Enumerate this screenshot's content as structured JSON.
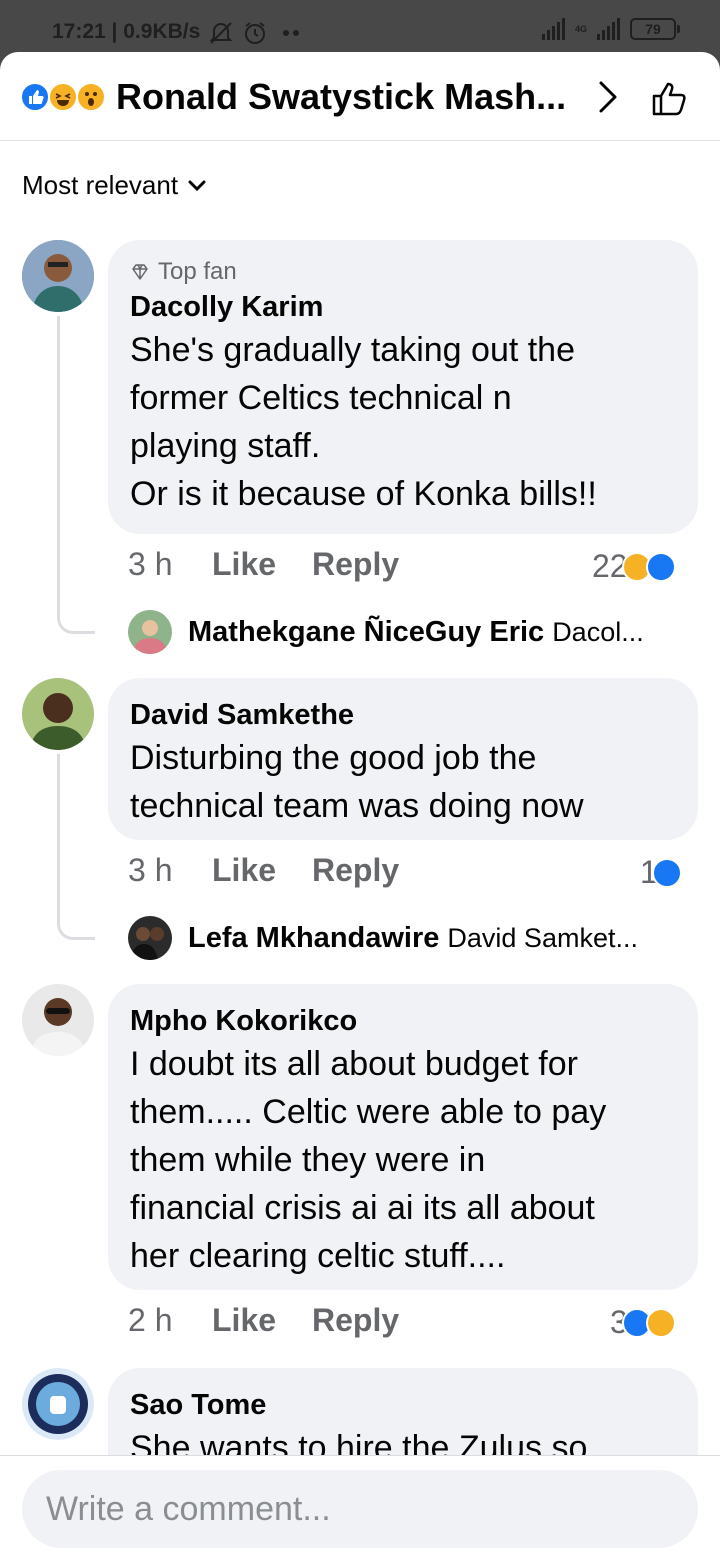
{
  "status_bar": {
    "time": "17:21 | 0.9KB/s",
    "network": "4G",
    "battery": "79"
  },
  "header": {
    "title": "Ronald Swatystick Mash...",
    "reaction_icons": [
      "like-icon",
      "haha-icon",
      "wow-icon"
    ]
  },
  "sort": {
    "label": "Most relevant"
  },
  "comments": [
    {
      "badge": "Top fan",
      "author": "Dacolly Karim",
      "text": "She's gradually taking out the\nformer Celtics technical n\nplaying staff.\nOr is it because of Konka bills!!",
      "time": "3 h",
      "like": "Like",
      "reply": "Reply",
      "reaction_count": "22",
      "reply_preview": {
        "author": "Mathekgane ÑiceGuy Eric",
        "text": "Dacol..."
      }
    },
    {
      "author": "David Samkethe",
      "text": "Disturbing the good job the\ntechnical team was doing now",
      "time": "3 h",
      "like": "Like",
      "reply": "Reply",
      "reaction_count": "1",
      "reply_preview": {
        "author": "Lefa Mkhandawire",
        "text": "David Samket..."
      }
    },
    {
      "author": "Mpho Kokorikco",
      "text": "I doubt its all about budget for\nthem.....  Celtic were able to pay\nthem while they were in\nfinancial crisis ai ai its all about\nher clearing celtic stuff....",
      "time": "2 h",
      "like": "Like",
      "reply": "Reply",
      "reaction_count": "3"
    },
    {
      "author": "Sao Tome",
      "text": "She wants to hire the Zulus so"
    }
  ],
  "composer": {
    "placeholder": "Write a comment..."
  },
  "colors": {
    "accent": "#1877f2",
    "bubble": "#f0f2f5",
    "muted": "#65676b"
  }
}
